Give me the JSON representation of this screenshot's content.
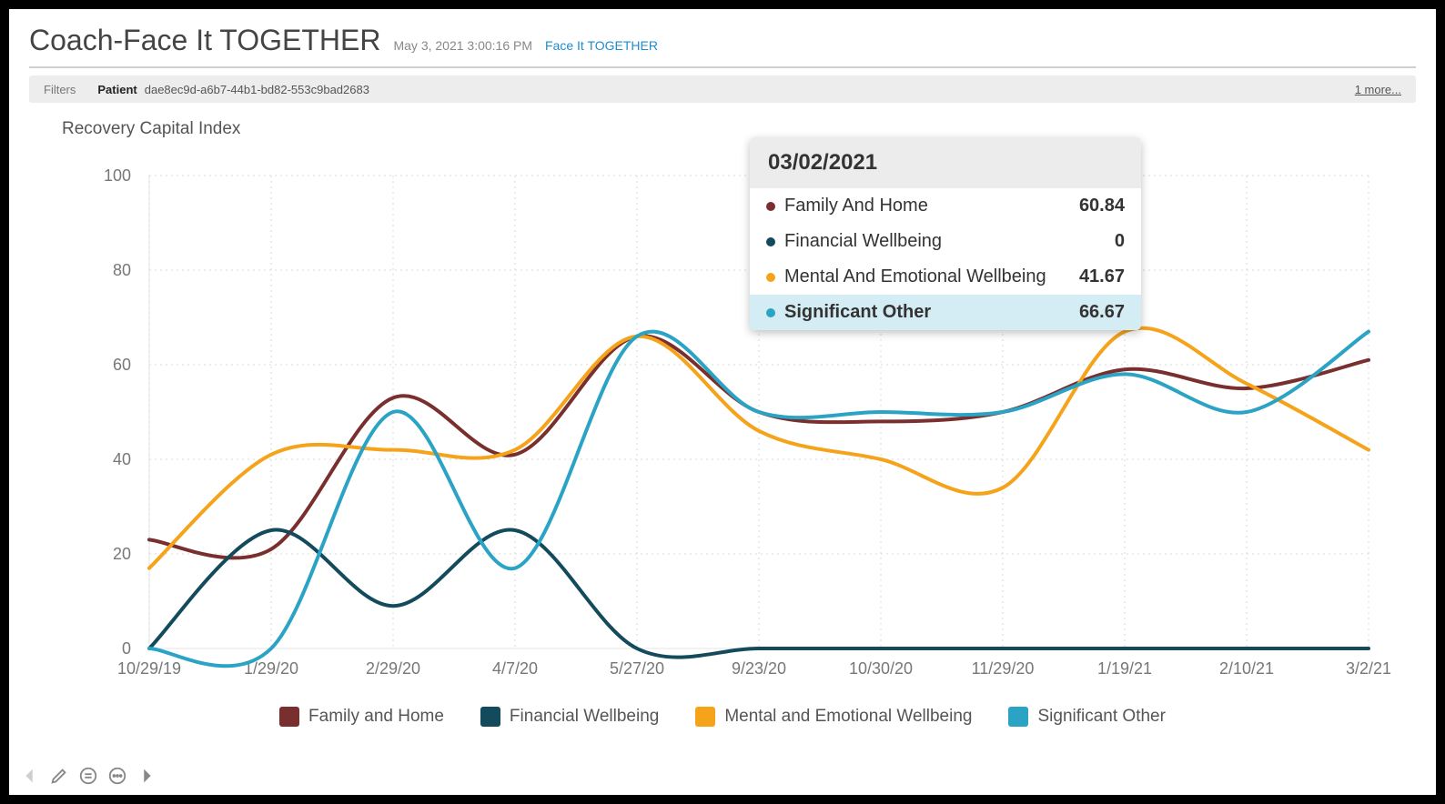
{
  "header": {
    "title": "Coach-Face It TOGETHER",
    "timestamp": "May 3, 2021 3:00:16 PM",
    "link_label": "Face It TOGETHER"
  },
  "filters": {
    "label": "Filters",
    "patient_label": "Patient",
    "patient_value": "dae8ec9d-a6b7-44b1-bd82-553c9bad2683",
    "more_label": "1 more..."
  },
  "chart_title": "Recovery Capital Index",
  "colors": {
    "family": "#7a2f2f",
    "financial": "#134a5c",
    "mental": "#f5a31b",
    "significant": "#2aa3c4"
  },
  "legend": [
    {
      "key": "family",
      "label": "Family and Home"
    },
    {
      "key": "financial",
      "label": "Financial Wellbeing"
    },
    {
      "key": "mental",
      "label": "Mental and Emotional Wellbeing"
    },
    {
      "key": "significant",
      "label": "Significant Other"
    }
  ],
  "tooltip": {
    "title": "03/02/2021",
    "rows": [
      {
        "key": "family",
        "label": "Family And Home",
        "value": "60.84"
      },
      {
        "key": "financial",
        "label": "Financial Wellbeing",
        "value": "0"
      },
      {
        "key": "mental",
        "label": "Mental And Emotional Wellbeing",
        "value": "41.67"
      },
      {
        "key": "significant",
        "label": "Significant Other",
        "value": "66.67",
        "highlight": true
      }
    ]
  },
  "chart_data": {
    "type": "line",
    "title": "Recovery Capital Index",
    "xlabel": "",
    "ylabel": "",
    "ylim": [
      0,
      100
    ],
    "y_ticks": [
      0,
      20,
      40,
      60,
      80,
      100
    ],
    "categories": [
      "10/29/19",
      "1/29/20",
      "2/29/20",
      "4/7/20",
      "5/27/20",
      "9/23/20",
      "10/30/20",
      "11/29/20",
      "1/19/21",
      "2/10/21",
      "3/2/21"
    ],
    "series": [
      {
        "name": "Family and Home",
        "key": "family",
        "values": [
          23,
          21,
          53,
          41,
          66,
          50,
          48,
          50,
          59,
          55,
          61
        ]
      },
      {
        "name": "Financial Wellbeing",
        "key": "financial",
        "values": [
          0,
          25,
          9,
          25,
          0,
          0,
          0,
          0,
          0,
          0,
          0
        ]
      },
      {
        "name": "Mental and Emotional Wellbeing",
        "key": "mental",
        "values": [
          17,
          41,
          42,
          42,
          66,
          46,
          40,
          34,
          67,
          56,
          42
        ]
      },
      {
        "name": "Significant Other",
        "key": "significant",
        "values": [
          0,
          0,
          50,
          17,
          66,
          50,
          50,
          50,
          58,
          50,
          67
        ]
      }
    ]
  }
}
